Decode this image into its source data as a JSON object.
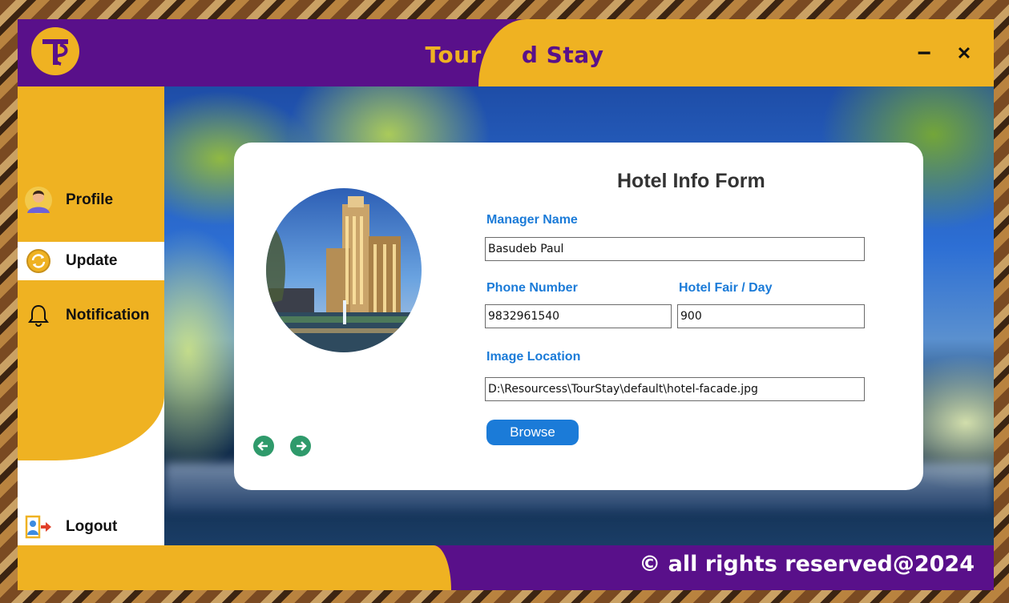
{
  "app": {
    "title_part1": "Tour an",
    "title_part2": "d Stay",
    "minimize_label": "−",
    "close_label": "✕",
    "logo_icon": "ts-logo"
  },
  "sidebar": {
    "items": [
      {
        "label": "Profile",
        "icon": "profile-avatar-icon",
        "active": false
      },
      {
        "label": "Update",
        "icon": "refresh-icon",
        "active": true
      },
      {
        "label": "Notification",
        "icon": "bell-icon",
        "active": false
      }
    ],
    "logout": {
      "label": "Logout",
      "icon": "logout-icon"
    }
  },
  "form": {
    "title": "Hotel Info Form",
    "manager_name": {
      "label": "Manager Name",
      "value": "Basudeb Paul"
    },
    "phone_number": {
      "label": "Phone Number",
      "value": "9832961540"
    },
    "hotel_fair": {
      "label": "Hotel Fair / Day",
      "value": "900"
    },
    "image_location": {
      "label": "Image Location",
      "value": "D:\\Resourcess\\TourStay\\default\\hotel-facade.jpg"
    },
    "browse_label": "Browse",
    "image_icon": "hotel-photo",
    "nav": {
      "prev_icon": "arrow-left-icon",
      "next_icon": "arrow-right-icon"
    }
  },
  "footer": {
    "copyright": "© all rights reserved@2024"
  },
  "colors": {
    "purple": "#59108a",
    "yellow": "#efb222",
    "blue_label": "#1b7bd8",
    "green_arrow": "#2f9a6b"
  }
}
